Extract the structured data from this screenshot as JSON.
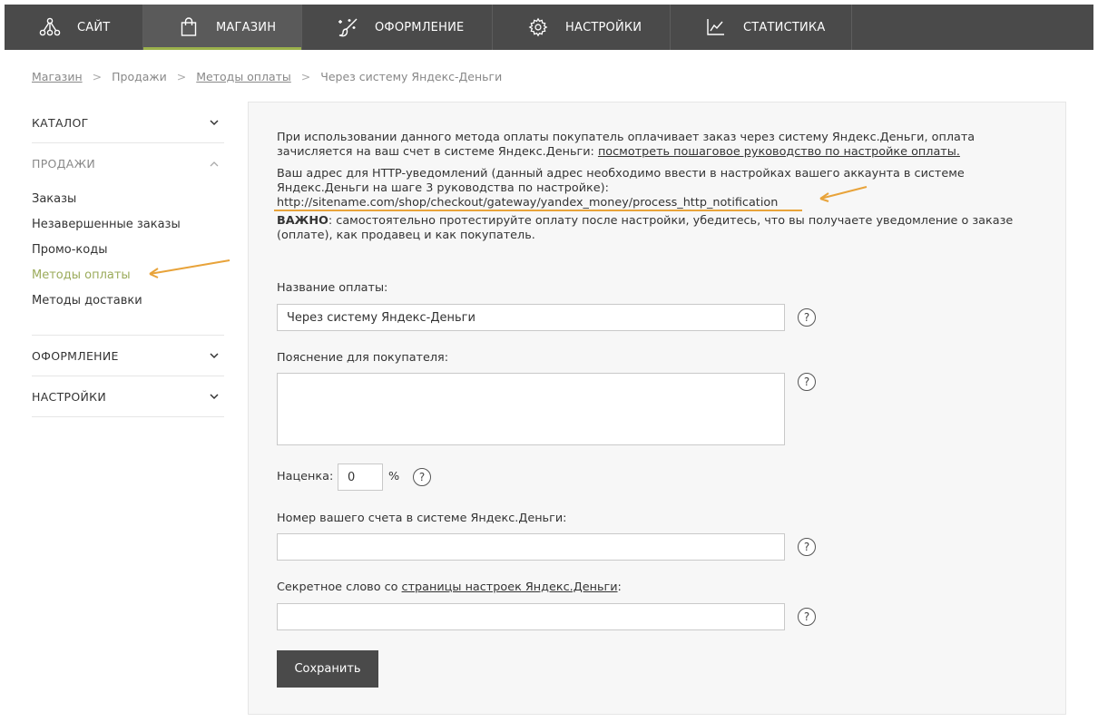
{
  "topnav": {
    "tabs": [
      {
        "label": "САЙТ",
        "icon": "network-icon"
      },
      {
        "label": "МАГАЗИН",
        "icon": "shopping-bag-icon",
        "active": true
      },
      {
        "label": "ОФОРМЛЕНИЕ",
        "icon": "magic-brush-icon"
      },
      {
        "label": "НАСТРОЙКИ",
        "icon": "gear-icon"
      },
      {
        "label": "СТАТИСТИКА",
        "icon": "chart-line-icon"
      }
    ]
  },
  "breadcrumb": {
    "items": [
      "Магазин",
      "Продажи",
      "Методы оплаты",
      "Через систему Яндекс-Деньги"
    ],
    "separator": ">"
  },
  "sidebar": {
    "catalog": "КАТАЛОГ",
    "sales": "ПРОДАЖИ",
    "sales_items": [
      "Заказы",
      "Незавершенные заказы",
      "Промо-коды",
      "Методы оплаты",
      "Методы доставки"
    ],
    "design": "ОФОРМЛЕНИЕ",
    "settings": "НАСТРОЙКИ"
  },
  "info": {
    "p1_text": "При использовании данного метода оплаты покупатель оплачивает заказ через систему Яндекс.Деньги, оплата зачисляется на ваш счет в системе Яндекс.Деньги: ",
    "p1_link": "посмотреть пошаговое руководство по настройке оплаты.",
    "p2_text": "Ваш адрес для HTTP-уведомлений (данный адрес необходимо ввести в настройках вашего аккаунта в системе Яндекс.Деньги на шаге 3 руководства по настройке):",
    "p2_url": "http://sitename.com/shop/checkout/gateway/yandex_money/process_http_notification",
    "p3_bold": "ВАЖНО",
    "p3_text": ": самостоятельно протестируйте оплату после настройки, убедитесь, что вы получаете уведомление о заказе (оплате), как продавец и как покупатель."
  },
  "form": {
    "name_label": "Название оплаты:",
    "name_value": "Через систему Яндекс-Деньги",
    "desc_label": "Пояснение для покупателя:",
    "desc_value": "",
    "markup_label": "Наценка:",
    "markup_value": "0",
    "markup_unit": "%",
    "account_label": "Номер вашего счета в системе Яндекс.Деньги:",
    "account_value": "",
    "secret_label_prefix": "Секретное слово со ",
    "secret_label_link": "страницы настроек Яндекс.Деньги",
    "secret_label_suffix": ":",
    "secret_value": "",
    "help_glyph": "?",
    "save_label": "Сохранить"
  },
  "colors": {
    "nav_bg": "#4a4a4a",
    "accent_green": "#9bb14b",
    "annotation_orange": "#e8a33a"
  }
}
